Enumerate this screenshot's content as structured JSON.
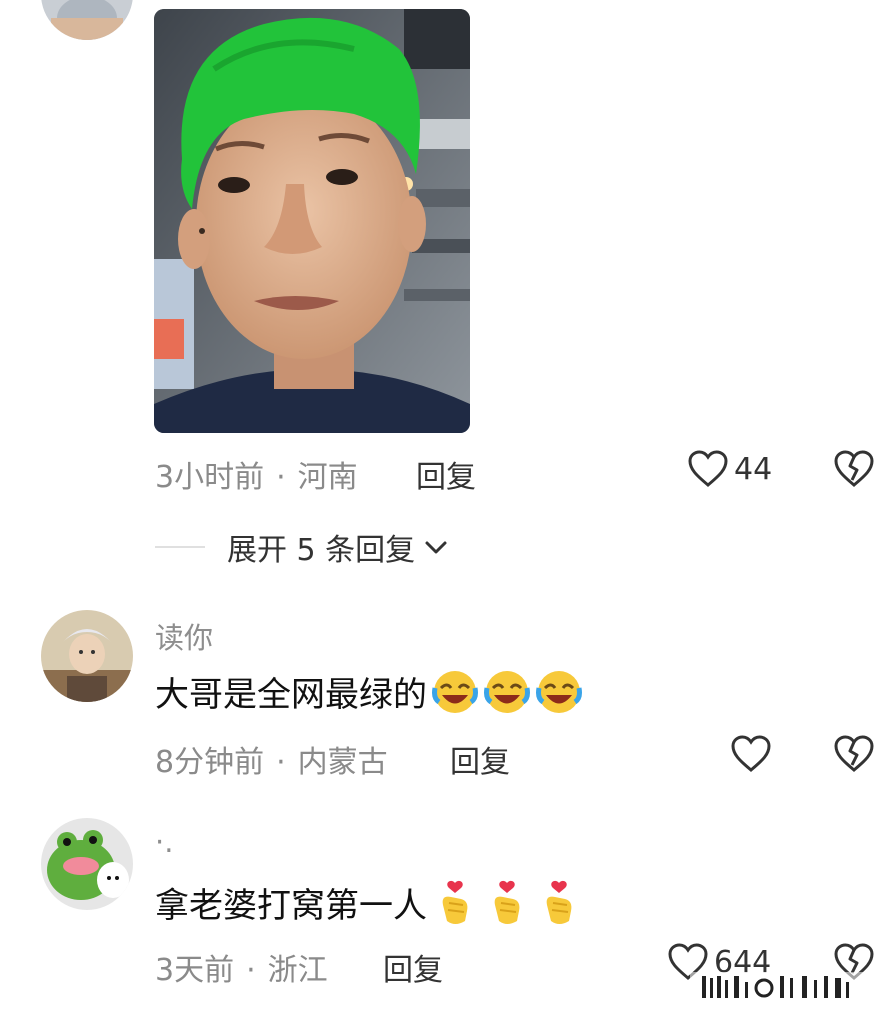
{
  "top_comment": {
    "time": "3小时前",
    "separator": "·",
    "location": "河南",
    "reply_label": "回复",
    "like_count": "44",
    "expand_label": "展开 5 条回复"
  },
  "comments": [
    {
      "username": "读你",
      "text": "大哥是全网最绿的",
      "emoji": "laugh-cry",
      "time": "8分钟前",
      "separator": "·",
      "location": "内蒙古",
      "reply_label": "回复"
    },
    {
      "username": "·.",
      "text": "拿老婆打窝第一人",
      "emoji": "finger-heart",
      "time": "3天前",
      "separator": "·",
      "location": "浙江",
      "reply_label": "回复",
      "like_count": "644"
    }
  ],
  "colors": {
    "meta_gray": "#8a8a8a",
    "hair_green": "#22c33a"
  }
}
